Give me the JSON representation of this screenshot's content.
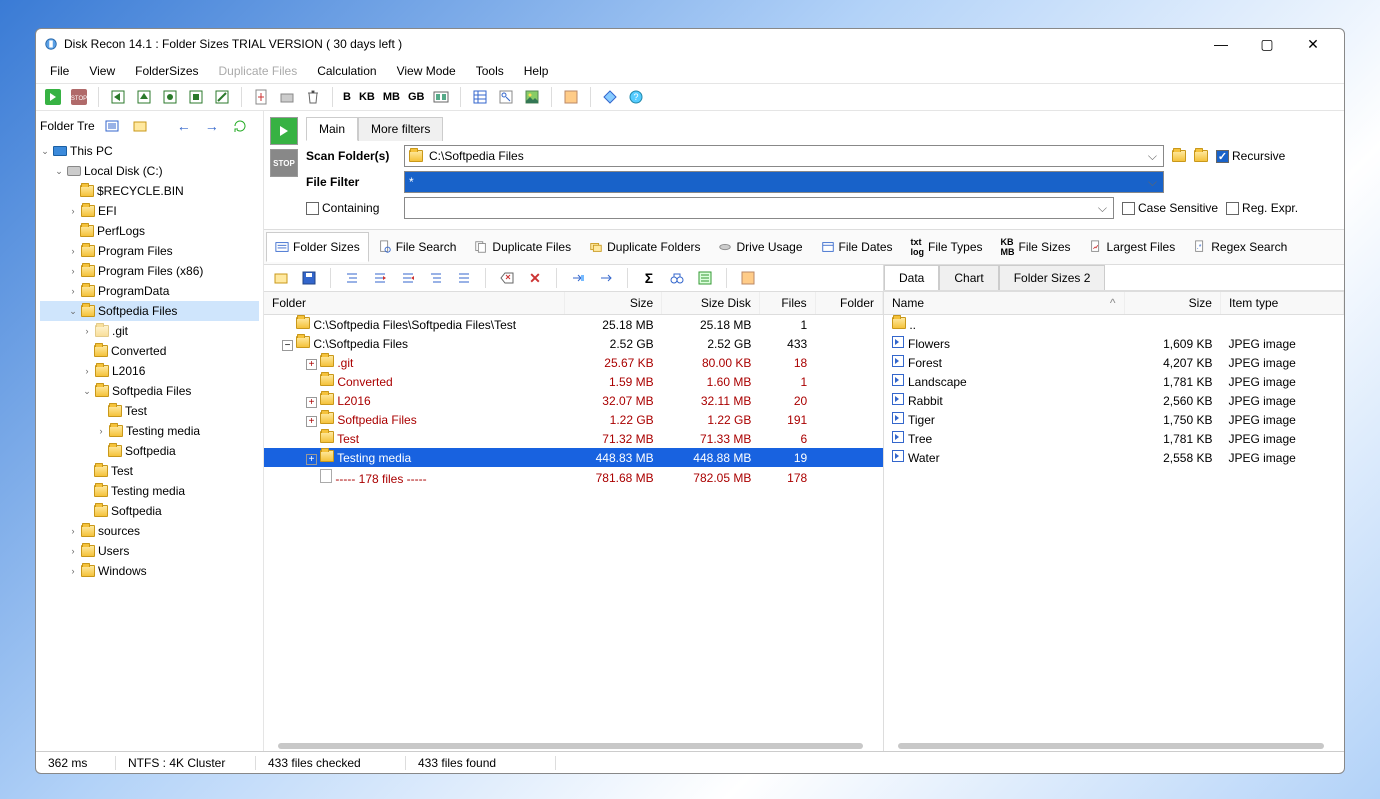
{
  "title": "Disk Recon 14.1 : Folder Sizes  TRIAL VERSION ( 30 days left )",
  "menu": {
    "file": "File",
    "view": "View",
    "foldersizes": "FolderSizes",
    "dup": "Duplicate Files",
    "calc": "Calculation",
    "viewmode": "View Mode",
    "tools": "Tools",
    "help": "Help"
  },
  "units": {
    "b": "B",
    "kb": "KB",
    "mb": "MB",
    "gb": "GB"
  },
  "leftToolbarLabel": "Folder Tre",
  "tree": {
    "root": "This PC",
    "disk": "Local Disk (C:)",
    "nodes": [
      "$RECYCLE.BIN",
      "EFI",
      "PerfLogs",
      "Program Files",
      "Program Files (x86)",
      "ProgramData"
    ],
    "sp": "Softpedia Files",
    "spkids": [
      ".git",
      "Converted",
      "L2016"
    ],
    "sp2": "Softpedia Files",
    "sp2kids": [
      "Test",
      "Testing media",
      "Softpedia"
    ],
    "spafter": [
      "Test",
      "Testing media",
      "Softpedia"
    ],
    "after": [
      "sources",
      "Users",
      "Windows"
    ]
  },
  "scantabs": {
    "main": "Main",
    "more": "More filters"
  },
  "scan": {
    "folders": "Scan Folder(s)",
    "path": "C:\\Softpedia Files",
    "filter": "File Filter",
    "filterVal": "*",
    "containing": "Containing",
    "recursive": "Recursive",
    "cs": "Case Sensitive",
    "re": "Reg. Expr."
  },
  "viewtabs": [
    "Folder Sizes",
    "File Search",
    "Duplicate Files",
    "Duplicate Folders",
    "Drive Usage",
    "File Dates",
    "File Types",
    "File Sizes",
    "Largest Files",
    "Regex Search"
  ],
  "gridcols": {
    "folder": "Folder",
    "size": "Size",
    "sizedisk": "Size Disk",
    "files": "Files",
    "folders": "Folder"
  },
  "gridrows": [
    {
      "ind": 0,
      "exp": "",
      "name": "C:\\Softpedia Files\\Softpedia Files\\Test",
      "size": "25.18 MB",
      "sized": "25.18 MB",
      "files": "1",
      "cls": ""
    },
    {
      "ind": 0,
      "exp": "-",
      "name": "C:\\Softpedia Files",
      "size": "2.52 GB",
      "sized": "2.52 GB",
      "files": "433",
      "cls": ""
    },
    {
      "ind": 1,
      "exp": "+",
      "name": ".git",
      "size": "25.67 KB",
      "sized": "80.00 KB",
      "files": "18",
      "cls": "red"
    },
    {
      "ind": 1,
      "exp": "",
      "name": "Converted",
      "size": "1.59 MB",
      "sized": "1.60 MB",
      "files": "1",
      "cls": "red"
    },
    {
      "ind": 1,
      "exp": "+",
      "name": "L2016",
      "size": "32.07 MB",
      "sized": "32.11 MB",
      "files": "20",
      "cls": "red"
    },
    {
      "ind": 1,
      "exp": "+",
      "name": "Softpedia Files",
      "size": "1.22 GB",
      "sized": "1.22 GB",
      "files": "191",
      "cls": "red"
    },
    {
      "ind": 1,
      "exp": "",
      "name": "Test",
      "size": "71.32 MB",
      "sized": "71.33 MB",
      "files": "6",
      "cls": "red"
    },
    {
      "ind": 1,
      "exp": "+",
      "name": "Testing media",
      "size": "448.83 MB",
      "sized": "448.88 MB",
      "files": "19",
      "cls": "sel"
    },
    {
      "ind": 1,
      "exp": "",
      "name": "----- 178 files -----",
      "size": "781.68 MB",
      "sized": "782.05 MB",
      "files": "178",
      "cls": "red2",
      "file": true
    }
  ],
  "rtabs": {
    "data": "Data",
    "chart": "Chart",
    "fs2": "Folder Sizes 2"
  },
  "rcols": {
    "name": "Name",
    "size": "Size",
    "type": "Item type"
  },
  "up": "..",
  "rrows": [
    {
      "name": "Flowers",
      "size": "1,609 KB",
      "type": "JPEG image"
    },
    {
      "name": "Forest",
      "size": "4,207 KB",
      "type": "JPEG image"
    },
    {
      "name": "Landscape",
      "size": "1,781 KB",
      "type": "JPEG image"
    },
    {
      "name": "Rabbit",
      "size": "2,560 KB",
      "type": "JPEG image"
    },
    {
      "name": "Tiger",
      "size": "1,750 KB",
      "type": "JPEG image"
    },
    {
      "name": "Tree",
      "size": "1,781 KB",
      "type": "JPEG image"
    },
    {
      "name": "Water",
      "size": "2,558 KB",
      "type": "JPEG image"
    }
  ],
  "status": {
    "time": "362 ms",
    "fs": "NTFS : 4K Cluster",
    "checked": "433 files checked",
    "found": "433 files found"
  }
}
